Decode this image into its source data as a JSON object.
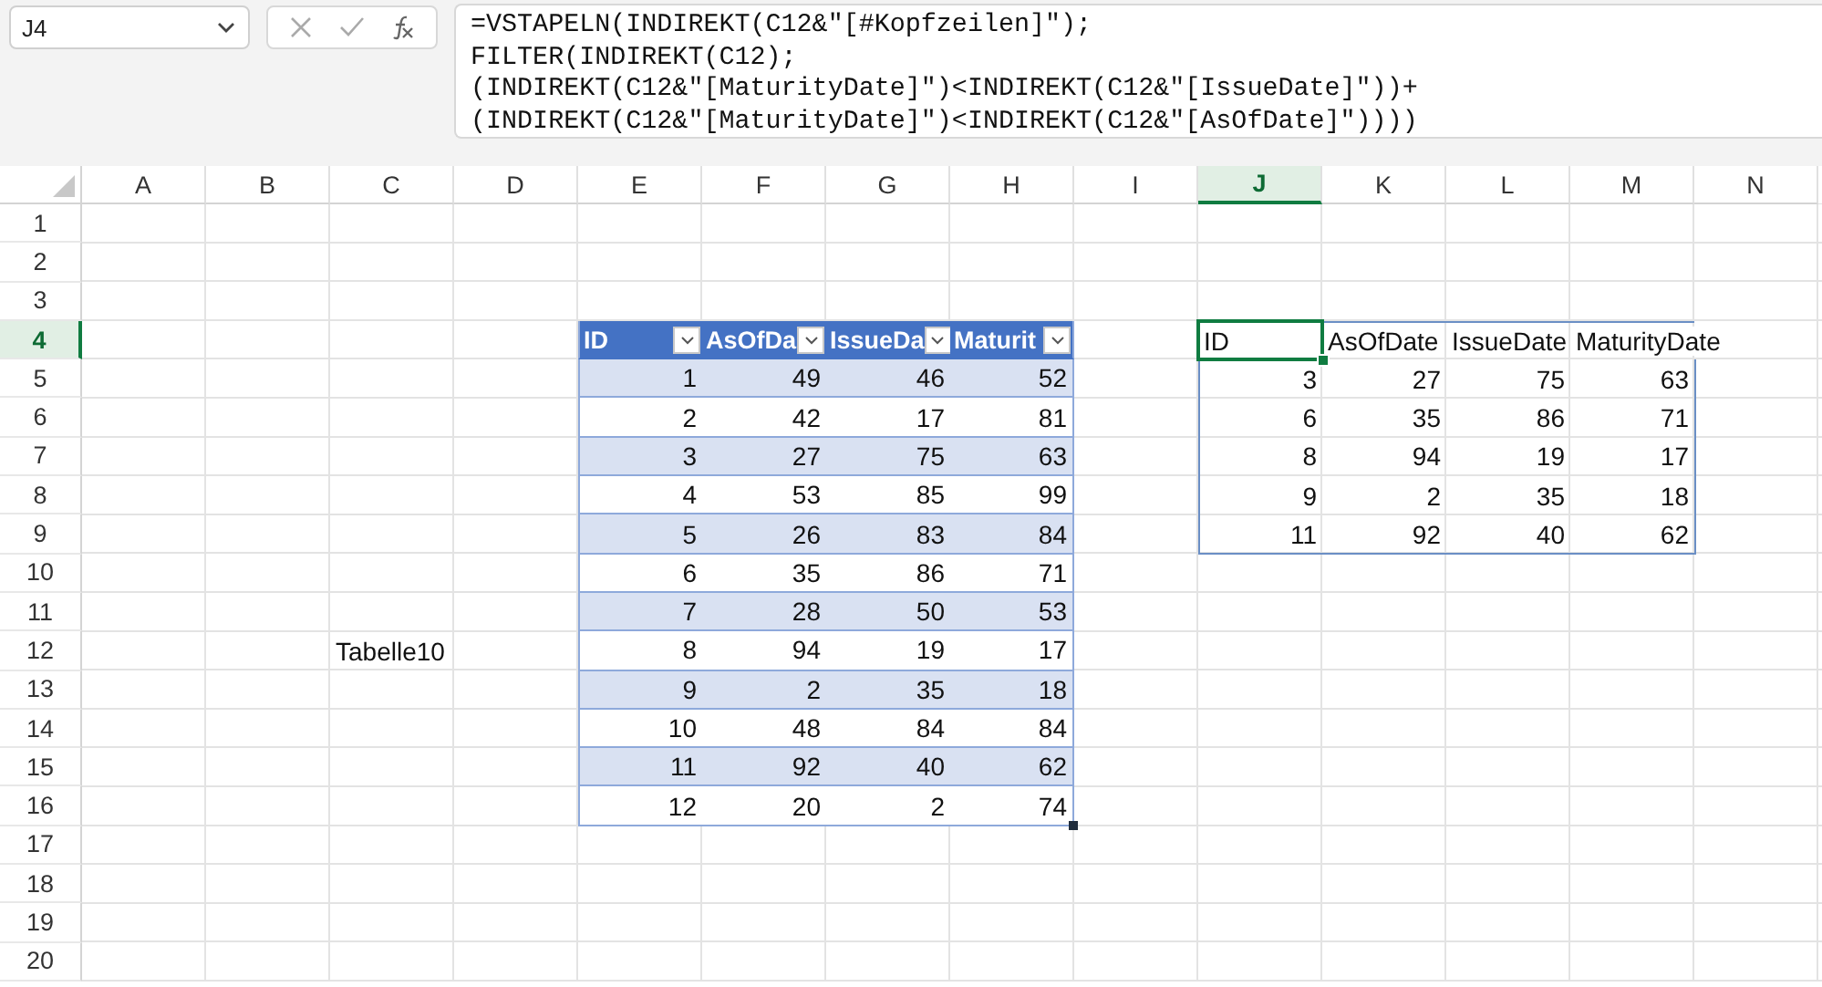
{
  "name_box": {
    "value": "J4"
  },
  "formula_bar": {
    "lines": [
      "=VSTAPELN(INDIREKT(C12&\"[#Kopfzeilen]\");",
      "FILTER(INDIREKT(C12);",
      "(INDIREKT(C12&\"[MaturityDate]\")<INDIREKT(C12&\"[IssueDate]\"))+",
      "(INDIREKT(C12&\"[MaturityDate]\")<INDIREKT(C12&\"[AsOfDate]\"))))"
    ]
  },
  "column_headers": [
    {
      "label": "A",
      "selected": false
    },
    {
      "label": "B",
      "selected": false
    },
    {
      "label": "C",
      "selected": false
    },
    {
      "label": "D",
      "selected": false
    },
    {
      "label": "E",
      "selected": false
    },
    {
      "label": "F",
      "selected": false
    },
    {
      "label": "G",
      "selected": false
    },
    {
      "label": "H",
      "selected": false
    },
    {
      "label": "I",
      "selected": false
    },
    {
      "label": "J",
      "selected": true
    },
    {
      "label": "K",
      "selected": false
    },
    {
      "label": "L",
      "selected": false
    },
    {
      "label": "M",
      "selected": false
    },
    {
      "label": "N",
      "selected": false
    }
  ],
  "row_headers": [
    {
      "label": "1",
      "selected": false
    },
    {
      "label": "2",
      "selected": false
    },
    {
      "label": "3",
      "selected": false
    },
    {
      "label": "4",
      "selected": true
    },
    {
      "label": "5",
      "selected": false
    },
    {
      "label": "6",
      "selected": false
    },
    {
      "label": "7",
      "selected": false
    },
    {
      "label": "8",
      "selected": false
    },
    {
      "label": "9",
      "selected": false
    },
    {
      "label": "10",
      "selected": false
    },
    {
      "label": "11",
      "selected": false
    },
    {
      "label": "12",
      "selected": false
    },
    {
      "label": "13",
      "selected": false
    },
    {
      "label": "14",
      "selected": false
    },
    {
      "label": "15",
      "selected": false
    },
    {
      "label": "16",
      "selected": false
    },
    {
      "label": "17",
      "selected": false
    },
    {
      "label": "18",
      "selected": false
    },
    {
      "label": "19",
      "selected": false
    },
    {
      "label": "20",
      "selected": false
    }
  ],
  "label_cell": {
    "text": "Tabelle10"
  },
  "source_table": {
    "columns": [
      "ID",
      "AsOfDa",
      "IssueDa",
      "Maturit"
    ],
    "rows": [
      [
        "1",
        "49",
        "46",
        "52"
      ],
      [
        "2",
        "42",
        "17",
        "81"
      ],
      [
        "3",
        "27",
        "75",
        "63"
      ],
      [
        "4",
        "53",
        "85",
        "99"
      ],
      [
        "5",
        "26",
        "83",
        "84"
      ],
      [
        "6",
        "35",
        "86",
        "71"
      ],
      [
        "7",
        "28",
        "50",
        "53"
      ],
      [
        "8",
        "94",
        "19",
        "17"
      ],
      [
        "9",
        "2",
        "35",
        "18"
      ],
      [
        "10",
        "48",
        "84",
        "84"
      ],
      [
        "11",
        "92",
        "40",
        "62"
      ],
      [
        "12",
        "20",
        "2",
        "74"
      ]
    ]
  },
  "spill_result": {
    "columns": [
      "ID",
      "AsOfDate",
      "IssueDate",
      "MaturityDate"
    ],
    "rows": [
      [
        "3",
        "27",
        "75",
        "63"
      ],
      [
        "6",
        "35",
        "86",
        "71"
      ],
      [
        "8",
        "94",
        "19",
        "17"
      ],
      [
        "9",
        "2",
        "35",
        "18"
      ],
      [
        "11",
        "92",
        "40",
        "62"
      ]
    ]
  }
}
